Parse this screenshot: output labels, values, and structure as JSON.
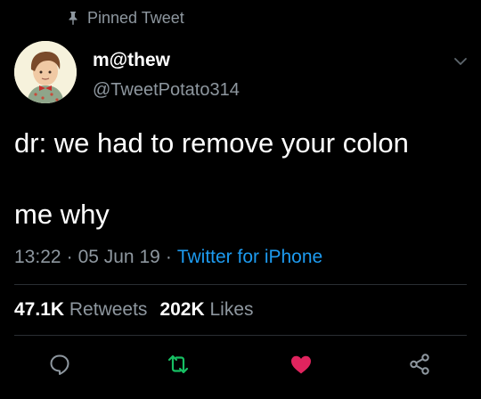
{
  "pinned": {
    "label": "Pinned Tweet",
    "icon": "pin-icon"
  },
  "author": {
    "name": "m@thew",
    "handle": "@TweetPotato314",
    "avatar": "avatar"
  },
  "tweet": {
    "line1": "dr: we had to remove your colon",
    "line2": "me why"
  },
  "meta": {
    "time": "13:22",
    "separator": "·",
    "date": "05 Jun 19",
    "source": "Twitter for iPhone"
  },
  "stats": {
    "retweets_count": "47.1K",
    "retweets_label": "Retweets",
    "likes_count": "202K",
    "likes_label": "Likes"
  },
  "actions": {
    "reply": "reply-icon",
    "retweet": "retweet-icon",
    "like": "heart-icon",
    "share": "share-icon"
  },
  "colors": {
    "background": "#000000",
    "muted_text": "#8e979f",
    "link": "#1d9bf0",
    "retweet": "#17bf63",
    "like": "#e0245e"
  }
}
